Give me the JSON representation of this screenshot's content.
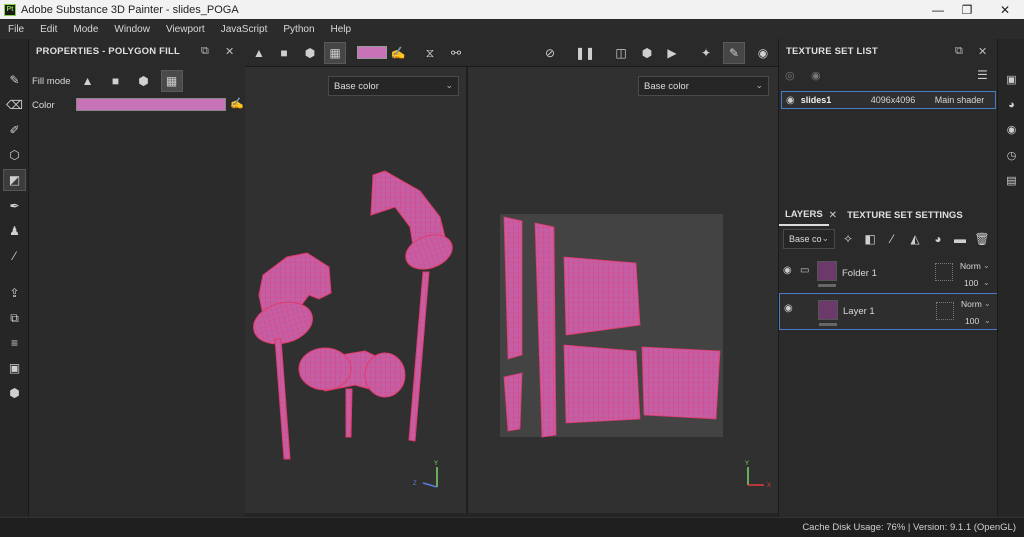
{
  "app": {
    "icon_text": "Pt",
    "title": "Adobe Substance 3D Painter - slides_POGA",
    "window_controls": {
      "minimize": "—",
      "maximize": "❐",
      "close": "✕"
    }
  },
  "menu": [
    "File",
    "Edit",
    "Mode",
    "Window",
    "Viewport",
    "JavaScript",
    "Python",
    "Help"
  ],
  "properties": {
    "title": "PROPERTIES - POLYGON FILL",
    "fill_mode_label": "Fill mode",
    "color_label": "Color",
    "color_value": "#c872b7"
  },
  "viewport": {
    "left_channel": "Base color",
    "right_channel": "Base color",
    "axis": {
      "y": "Y",
      "z": "Z",
      "x": "X"
    }
  },
  "texture_set_list": {
    "title": "TEXTURE SET LIST",
    "rows": [
      {
        "name": "slides1",
        "resolution": "4096x4096",
        "shader": "Main shader"
      }
    ]
  },
  "layers_panel": {
    "tabs": [
      "LAYERS",
      "TEXTURE SET SETTINGS"
    ],
    "channel_select": "Base co",
    "layers": [
      {
        "name": "Folder 1",
        "blend": "Norm",
        "opacity": "100"
      },
      {
        "name": "Layer 1",
        "blend": "Norm",
        "opacity": "100"
      }
    ]
  },
  "status": {
    "text": "Cache Disk Usage:   76% | Version: 9.1.1 (OpenGL)"
  },
  "colors": {
    "mesh_fill": "#c45fa6",
    "mesh_wire": "#e23a6a",
    "accent_select": "#4a7ac8"
  }
}
